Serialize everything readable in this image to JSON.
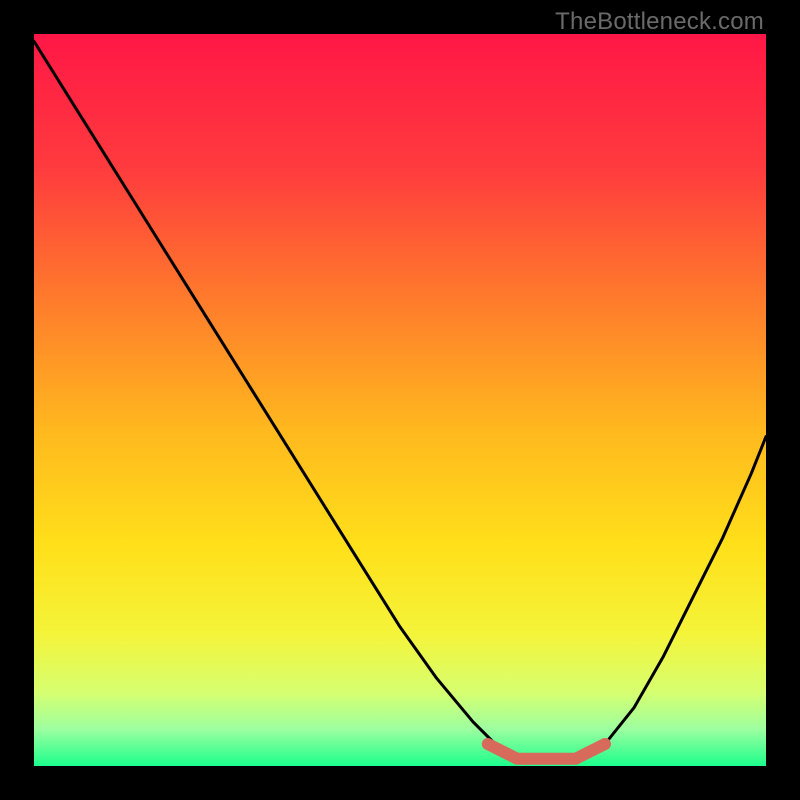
{
  "watermark": "TheBottleneck.com",
  "chart_data": {
    "type": "line",
    "title": "",
    "xlabel": "",
    "ylabel": "",
    "xlim": [
      0,
      100
    ],
    "ylim": [
      0,
      100
    ],
    "series": [
      {
        "name": "bottleneck-curve",
        "x": [
          0,
          5,
          10,
          15,
          20,
          25,
          30,
          35,
          40,
          45,
          50,
          55,
          60,
          63,
          66,
          70,
          74,
          78,
          82,
          86,
          90,
          94,
          98,
          100
        ],
        "values": [
          99,
          91,
          83,
          75,
          67,
          59,
          51,
          43,
          35,
          27,
          19,
          12,
          6,
          3,
          1,
          1,
          1,
          3,
          8,
          15,
          23,
          31,
          40,
          45
        ]
      },
      {
        "name": "optimum-marker",
        "x": [
          62,
          66,
          70,
          74,
          78
        ],
        "values": [
          3,
          1,
          1,
          1,
          3
        ]
      }
    ],
    "gradient_stops": [
      {
        "offset": 0.0,
        "color": "#ff1746"
      },
      {
        "offset": 0.18,
        "color": "#ff3a3e"
      },
      {
        "offset": 0.36,
        "color": "#ff7a2c"
      },
      {
        "offset": 0.54,
        "color": "#ffb81e"
      },
      {
        "offset": 0.7,
        "color": "#ffe01a"
      },
      {
        "offset": 0.82,
        "color": "#f4f43a"
      },
      {
        "offset": 0.9,
        "color": "#d6ff70"
      },
      {
        "offset": 0.95,
        "color": "#9cffa0"
      },
      {
        "offset": 1.0,
        "color": "#1cff8c"
      }
    ]
  }
}
